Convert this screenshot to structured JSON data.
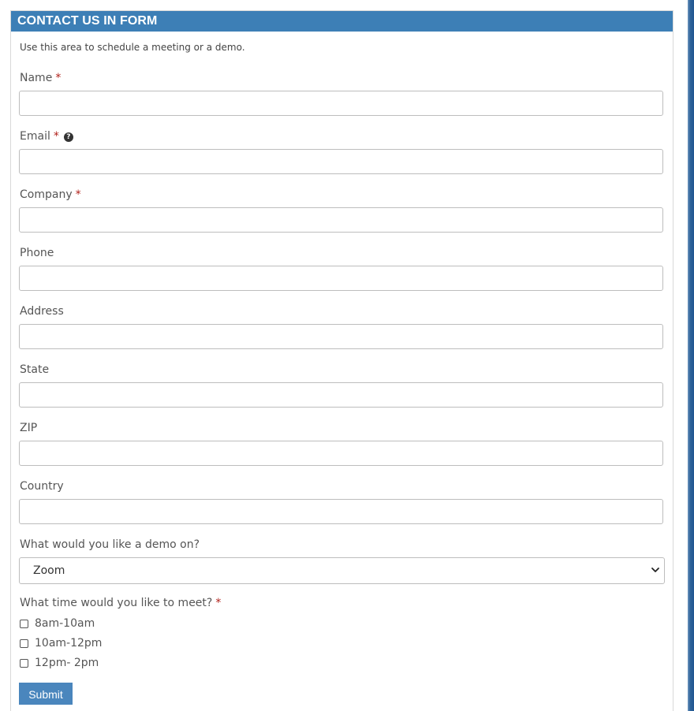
{
  "form": {
    "title": "CONTACT US IN FORM",
    "intro": "Use this area to schedule a meeting or a demo.",
    "required_marker": "*",
    "fields": {
      "name": {
        "label": "Name",
        "value": ""
      },
      "email": {
        "label": "Email",
        "value": "",
        "help_icon": "?"
      },
      "company": {
        "label": "Company",
        "value": ""
      },
      "phone": {
        "label": "Phone",
        "value": ""
      },
      "address": {
        "label": "Address",
        "value": ""
      },
      "state": {
        "label": "State",
        "value": ""
      },
      "zip": {
        "label": "ZIP",
        "value": ""
      },
      "country": {
        "label": "Country",
        "value": ""
      }
    },
    "demo": {
      "label": "What would you like a demo on?",
      "selected": "Zoom"
    },
    "meeting_time": {
      "label": "What time would you like to meet?",
      "options": [
        {
          "label": "8am-10am",
          "checked": false
        },
        {
          "label": "10am-12pm",
          "checked": false
        },
        {
          "label": "12pm- 2pm",
          "checked": false
        }
      ]
    },
    "submit_label": "Submit"
  },
  "colors": {
    "header_bg": "#3d7fb6",
    "required": "#b0201a",
    "submit_bg": "#4a86bd"
  },
  "icons": {
    "help": "question-circle-icon",
    "select_arrow": "chevron-down-icon"
  }
}
